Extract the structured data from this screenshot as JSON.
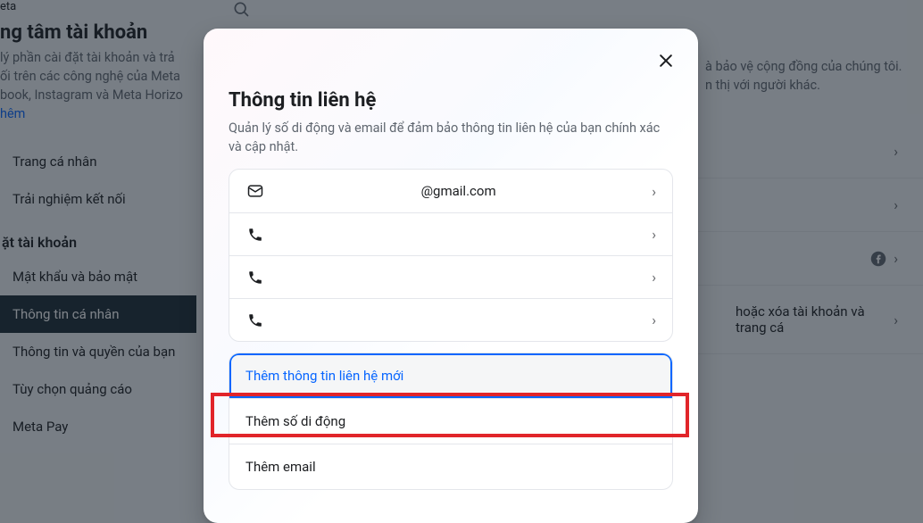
{
  "bg": {
    "brand": "eta",
    "heading": "ng tâm tài khoản",
    "desc_line1": "lý phần cài đặt tài khoản và trả",
    "desc_line2": "ối trên các công nghệ của Meta",
    "desc_line3": "book, Instagram và Meta Horizo",
    "learn_more": "hêm",
    "right_text_1": "à bảo vệ cộng đồng của chúng tôi.",
    "right_text_2": "n thị với người khác."
  },
  "sidebar": {
    "items": [
      {
        "label": "Trang cá nhân"
      },
      {
        "label": "Trải nghiệm kết nối"
      }
    ],
    "section": "ặt tài khoản",
    "items2": [
      {
        "label": "Mật khẩu và bảo mật"
      },
      {
        "label": "Thông tin cá nhân",
        "active": true
      },
      {
        "label": "Thông tin và quyền của bạn"
      },
      {
        "label": "Tùy chọn quảng cáo"
      },
      {
        "label": "Meta Pay"
      }
    ]
  },
  "right": {
    "row4_text": "hoặc xóa tài khoản và trang cá"
  },
  "modal": {
    "title": "Thông tin liên hệ",
    "subtitle": "Quản lý số di động và email để đảm bảo thông tin liên hệ của bạn chính xác và cập nhật.",
    "contacts": [
      {
        "icon": "mail",
        "label": "@gmail.com"
      },
      {
        "icon": "phone",
        "label": ""
      },
      {
        "icon": "phone",
        "label": ""
      },
      {
        "icon": "phone",
        "label": ""
      }
    ],
    "actions": {
      "add_new": "Thêm thông tin liên hệ mới",
      "add_phone": "Thêm số di động",
      "add_email": "Thêm email"
    }
  }
}
